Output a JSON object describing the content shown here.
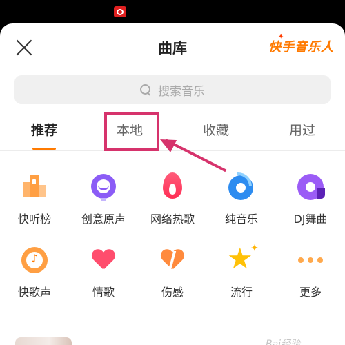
{
  "header": {
    "title": "曲库",
    "brand": "快手音乐人"
  },
  "search": {
    "placeholder": "搜索音乐"
  },
  "tabs": [
    {
      "label": "推荐",
      "active": true
    },
    {
      "label": "本地",
      "active": false,
      "highlighted": true
    },
    {
      "label": "收藏",
      "active": false
    },
    {
      "label": "用过",
      "active": false
    }
  ],
  "categories": [
    {
      "label": "快听榜",
      "icon": "chart-icon"
    },
    {
      "label": "创意原声",
      "icon": "mic-smile-icon"
    },
    {
      "label": "网络热歌",
      "icon": "flame-icon"
    },
    {
      "label": "纯音乐",
      "icon": "pure-music-icon"
    },
    {
      "label": "DJ舞曲",
      "icon": "vinyl-icon"
    },
    {
      "label": "快歌声",
      "icon": "music-note-icon"
    },
    {
      "label": "情歌",
      "icon": "heart-icon"
    },
    {
      "label": "伤感",
      "icon": "broken-heart-icon"
    },
    {
      "label": "流行",
      "icon": "star-icon"
    },
    {
      "label": "更多",
      "icon": "more-icon"
    }
  ],
  "colors": {
    "accent": "#ff7a00",
    "annotation": "#d6336c"
  },
  "watermark": "Bai经验"
}
